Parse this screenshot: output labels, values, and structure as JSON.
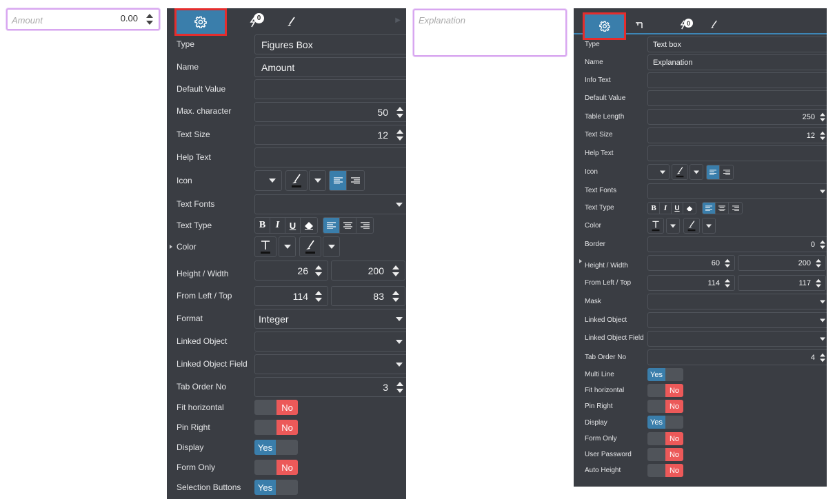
{
  "preview": {
    "amount": {
      "placeholder": "Amount",
      "value": "0.00"
    },
    "explanation": {
      "placeholder": "Explanation"
    }
  },
  "panel1": {
    "badge": "0",
    "type": {
      "label": "Type",
      "value": "Figures Box"
    },
    "name": {
      "label": "Name",
      "value": "Amount"
    },
    "default_value": {
      "label": "Default Value",
      "value": ""
    },
    "max_character": {
      "label": "Max. character",
      "value": "50"
    },
    "text_size": {
      "label": "Text Size",
      "value": "12"
    },
    "help_text": {
      "label": "Help Text",
      "value": ""
    },
    "icon": {
      "label": "Icon"
    },
    "text_fonts": {
      "label": "Text Fonts",
      "value": ""
    },
    "text_type": {
      "label": "Text Type"
    },
    "color": {
      "label": "Color"
    },
    "height_width": {
      "label": "Height / Width",
      "height": "26",
      "width": "200"
    },
    "from_left_top": {
      "label": "From Left / Top",
      "left": "114",
      "top": "83"
    },
    "format": {
      "label": "Format",
      "value": "Integer"
    },
    "linked_object": {
      "label": "Linked Object",
      "value": ""
    },
    "linked_object_field": {
      "label": "Linked Object Field",
      "value": ""
    },
    "tab_order": {
      "label": "Tab Order No",
      "value": "3"
    },
    "fit_horizontal": {
      "label": "Fit horizontal",
      "state": "No"
    },
    "pin_right": {
      "label": "Pin Right",
      "state": "No"
    },
    "display": {
      "label": "Display",
      "state": "Yes"
    },
    "form_only": {
      "label": "Form Only",
      "state": "No"
    },
    "selection_buttons": {
      "label": "Selection Buttons",
      "state": "Yes"
    }
  },
  "panel2": {
    "badge": "0",
    "type": {
      "label": "Type",
      "value": "Text box"
    },
    "name": {
      "label": "Name",
      "value": "Explanation"
    },
    "info_text": {
      "label": "Info Text",
      "value": ""
    },
    "default_value": {
      "label": "Default Value",
      "value": ""
    },
    "table_length": {
      "label": "Table Length",
      "value": "250"
    },
    "text_size": {
      "label": "Text Size",
      "value": "12"
    },
    "help_text": {
      "label": "Help Text",
      "value": ""
    },
    "icon": {
      "label": "Icon"
    },
    "text_fonts": {
      "label": "Text Fonts",
      "value": ""
    },
    "text_type": {
      "label": "Text Type"
    },
    "color": {
      "label": "Color"
    },
    "border": {
      "label": "Border",
      "value": "0"
    },
    "height_width": {
      "label": "Height / Width",
      "height": "60",
      "width": "200"
    },
    "from_left_top": {
      "label": "From Left / Top",
      "left": "114",
      "top": "117"
    },
    "mask": {
      "label": "Mask",
      "value": ""
    },
    "linked_object": {
      "label": "Linked Object",
      "value": ""
    },
    "linked_object_field": {
      "label": "Linked Object Field",
      "value": ""
    },
    "tab_order": {
      "label": "Tab Order No",
      "value": "4"
    },
    "multi_line": {
      "label": "Multi Line",
      "state": "Yes"
    },
    "fit_horizontal": {
      "label": "Fit horizontal",
      "state": "No"
    },
    "pin_right": {
      "label": "Pin Right",
      "state": "No"
    },
    "display": {
      "label": "Display",
      "state": "Yes"
    },
    "form_only": {
      "label": "Form Only",
      "state": "No"
    },
    "user_password": {
      "label": "User Password",
      "state": "No"
    },
    "auto_height": {
      "label": "Auto Height",
      "state": "No"
    }
  },
  "colors": {
    "panel_bg": "#3a3d43",
    "accent": "#3a7eab",
    "no": "#ec5959",
    "highlight": "#e52d2d",
    "preview_border": "#d8a6f0"
  },
  "icons": [
    "gear-icon",
    "lightning-icon",
    "brush-icon",
    "layout-icon",
    "bold-icon",
    "italic-icon",
    "underline-icon",
    "eraser-icon",
    "align-left-icon",
    "align-center-icon",
    "align-right-icon",
    "text-color-icon",
    "spinner-icon",
    "dropdown-icon"
  ]
}
